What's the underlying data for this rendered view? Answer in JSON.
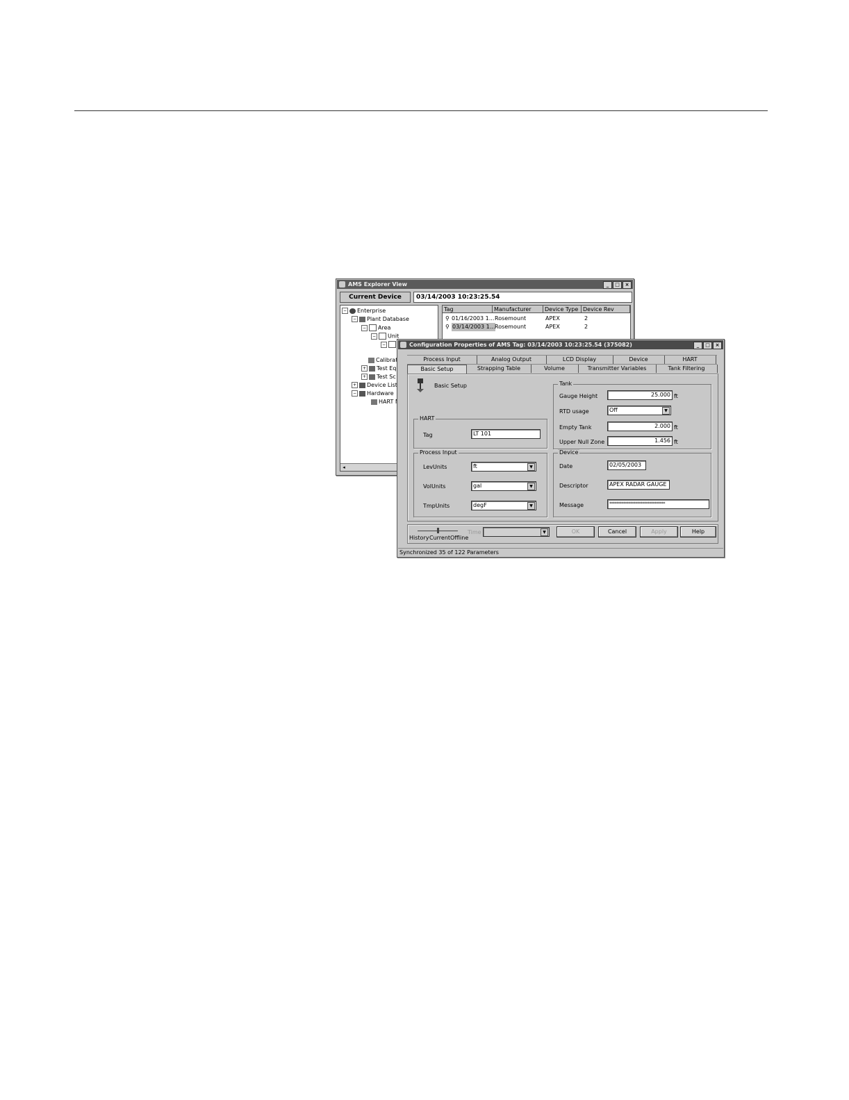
{
  "explorer": {
    "title": "AMS Explorer View",
    "current_device_label": "Current Device",
    "current_device_value": "03/14/2003 10:23:25.54",
    "tree": {
      "enterprise": "Enterprise",
      "plant_database": "Plant Database",
      "area": "Area",
      "unit": "Unit",
      "calibration": "Calibrat",
      "test_equipment": "Test Eq",
      "test_schemes": "Test Sc",
      "device_list": "Device List",
      "hardware": "Hardware",
      "hart_modem": "HART M"
    },
    "table": {
      "headers": [
        "Tag",
        "Manufacturer",
        "Device Type",
        "Device Rev"
      ],
      "rows": [
        [
          "01/16/2003 1...",
          "Rosemount",
          "APEX",
          "2"
        ],
        [
          "03/14/2003 1...",
          "Rosemount",
          "APEX",
          "2"
        ]
      ]
    }
  },
  "config": {
    "title": "Configuration Properties of AMS Tag: 03/14/2003 10:23:25.54 (375082)",
    "tabs_row1": [
      "Process Input",
      "Analog Output",
      "LCD Display",
      "Device",
      "HART"
    ],
    "tabs_row2": [
      "Basic Setup",
      "Strapping Table",
      "Volume",
      "Transmitter Variables",
      "Tank Filtering"
    ],
    "page_heading": "Basic Setup",
    "hart": {
      "group": "HART",
      "tag_label": "Tag",
      "tag_value": "LT 101"
    },
    "process_input": {
      "group": "Process Input",
      "lev_units_label": "LevUnits",
      "lev_units_value": "ft",
      "vol_units_label": "VolUnits",
      "vol_units_value": "gal",
      "tmp_units_label": "TmpUnits",
      "tmp_units_value": "degF"
    },
    "tank": {
      "group": "Tank",
      "gauge_height_label": "Gauge Height",
      "gauge_height_value": "25.000",
      "gauge_height_unit": "ft",
      "rtd_usage_label": "RTD usage",
      "rtd_usage_value": "Off",
      "empty_tank_label": "Empty Tank",
      "empty_tank_value": "2.000",
      "empty_tank_unit": "ft",
      "upper_null_zone_label": "Upper Null Zone",
      "upper_null_zone_value": "1.456",
      "upper_null_zone_unit": "ft"
    },
    "device": {
      "group": "Device",
      "date_label": "Date",
      "date_value": "02/05/2003",
      "descriptor_label": "Descriptor",
      "descriptor_value": "APEX RADAR GAUGE",
      "message_label": "Message",
      "message_value": "********************************"
    },
    "footer": {
      "history": "History",
      "current": "Current",
      "offline": "Offline",
      "time_label": "Time",
      "ok": "OK",
      "cancel": "Cancel",
      "apply": "Apply",
      "help": "Help"
    },
    "status": "Synchronized 35 of 122 Parameters"
  }
}
